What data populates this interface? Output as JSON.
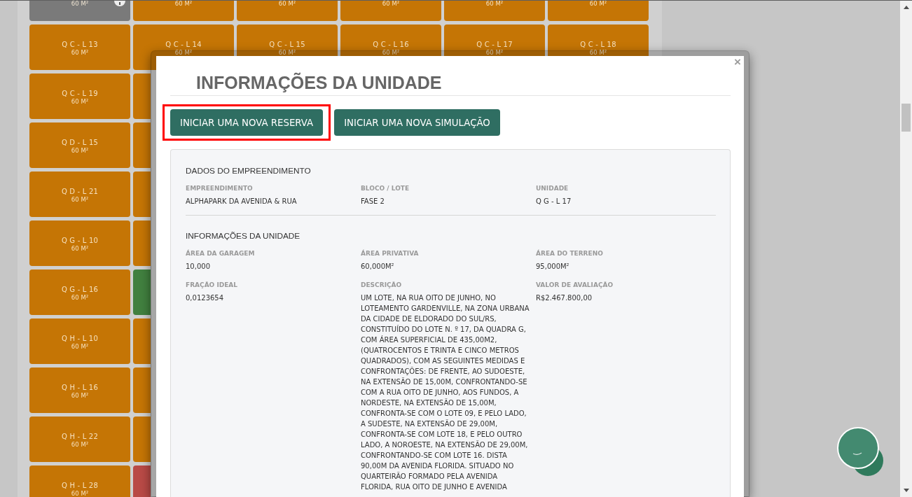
{
  "grid": {
    "rows": [
      {
        "tiles": [
          {
            "area": "60 M²",
            "color": "#7a7a7a",
            "info_badge": true
          },
          {
            "area": "60 M²",
            "color": "#c57505",
            "info_badge": false
          },
          {
            "area": "60 M²",
            "color": "#c57505",
            "info_badge": false
          },
          {
            "area": "60 M²",
            "color": "#c57505",
            "info_badge": false
          },
          {
            "area": "60 M²",
            "color": "#c57505",
            "info_badge": false
          },
          {
            "area": "60 M²",
            "color": "#c57505",
            "info_badge": false
          }
        ]
      },
      {
        "tiles": [
          {
            "label": "Q C - L 13",
            "area": "60 M²",
            "color": "#c57505",
            "info_badge": false
          },
          {
            "label": "Q C - L 14",
            "area": "60 M²",
            "color": "#c57505",
            "info_badge": false
          },
          {
            "label": "Q C - L 15",
            "area": "60 M²",
            "color": "#c57505",
            "info_badge": false
          },
          {
            "label": "Q C - L 16",
            "area": "60 M²",
            "color": "#c57505",
            "info_badge": false
          },
          {
            "label": "Q C - L 17",
            "area": "60 M²",
            "color": "#c57505",
            "info_badge": false
          },
          {
            "label": "Q C - L 18",
            "area": "60 M²",
            "color": "#c57505",
            "info_badge": false
          }
        ]
      },
      {
        "tiles": [
          {
            "label": "Q C - L 19",
            "area": "60 M²",
            "color": "#c57505",
            "info_badge": false
          },
          {
            "color": "#c57505",
            "info_badge": false
          }
        ]
      },
      {
        "tiles": [
          {
            "label": "Q D - L 15",
            "area": "60 M²",
            "color": "#c57505",
            "info_badge": false
          },
          {
            "color": "#c57505",
            "info_badge": false
          }
        ]
      },
      {
        "tiles": [
          {
            "label": "Q D - L 21",
            "area": "60 M²",
            "color": "#c57505",
            "info_badge": false
          },
          {
            "color": "#c57505",
            "info_badge": false
          }
        ]
      },
      {
        "tiles": [
          {
            "label": "Q G - L 10",
            "area": "60 M²",
            "color": "#c57505",
            "info_badge": false
          },
          {
            "color": "#c57505",
            "info_badge": false
          }
        ]
      },
      {
        "tiles": [
          {
            "label": "Q G - L 16",
            "area": "60 M²",
            "color": "#c57505",
            "info_badge": false
          },
          {
            "color": "#41803f",
            "info_badge": false
          }
        ]
      },
      {
        "tiles": [
          {
            "label": "Q H - L 10",
            "area": "60 M²",
            "color": "#c57505",
            "info_badge": false
          },
          {
            "color": "#c57505",
            "info_badge": false
          }
        ]
      },
      {
        "tiles": [
          {
            "label": "Q H - L 16",
            "area": "60 M²",
            "color": "#c57505",
            "info_badge": false
          },
          {
            "color": "#c57505",
            "info_badge": false
          }
        ]
      },
      {
        "tiles": [
          {
            "label": "Q H - L 22",
            "area": "60 M²",
            "color": "#c57505",
            "info_badge": false
          },
          {
            "color": "#c57505",
            "info_badge": false
          }
        ]
      },
      {
        "tiles": [
          {
            "label": "Q H - L 28",
            "area": "60 M²",
            "color": "#c57505",
            "info_badge": false
          },
          {
            "color": "#b94a46",
            "info_badge": false
          }
        ]
      }
    ]
  },
  "modal": {
    "close": "×",
    "title": "INFORMAÇÕES DA UNIDADE",
    "buttons": [
      {
        "label": "INICIAR UMA NOVA RESERVA",
        "highlighted": true
      },
      {
        "label": "INICIAR UMA NOVA SIMULAÇÃO",
        "highlighted": false
      }
    ],
    "sections": [
      {
        "title": "DADOS DO EMPREENDIMENTO",
        "fields": [
          {
            "label": "EMPREENDIMENTO",
            "value": "ALPHAPARK DA AVENIDA & RUA"
          },
          {
            "label": "BLOCO / LOTE",
            "value": "FASE 2"
          },
          {
            "label": "UNIDADE",
            "value": "Q G - L 17"
          }
        ]
      },
      {
        "title": "INFORMAÇÕES DA UNIDADE",
        "fields": [
          {
            "label": "ÁREA DA GARAGEM",
            "value": "10,000"
          },
          {
            "label": "ÁREA PRIVATIVA",
            "value": "60,000M²"
          },
          {
            "label": "ÁREA DO TERRENO",
            "value": "95,000M²"
          },
          {
            "label": "FRAÇÃO IDEAL",
            "value": "0,0123654"
          },
          {
            "label": "DESCRIÇÃO",
            "value": "UM LOTE, NA RUA OITO DE JUNHO, NO LOTEAMENTO GARDENVILLE, NA ZONA URBANA DA CIDADE DE ELDORADO DO SUL/RS, CONSTITUÍDO DO LOTE N. º 17, DA QUADRA G, COM ÁREA SUPERFICIAL DE 435,00M2, (QUATROCENTOS E TRINTA E CINCO METROS QUADRADOS), COM AS SEGUINTES MEDIDAS E CONFRONTAÇÕES: DE FRENTE, AO SUDOESTE, NA EXTENSÃO DE 15,00M, CONFRONTANDO-SE COM A RUA OITO DE JUNHO, AOS FUNDOS, A NORDESTE, NA EXTENSÃO DE 15,00M, CONFRONTA-SE COM O LOTE 09, E PELO LADO, A SUDESTE, NA EXTENSÃO DE 29,00M, CONFRONTA-SE COM LOTE 18, E PELO OUTRO LADO, A NOROESTE, NA EXTENSÃO DE 29,00M, CONFRONTANDO-SE COM LOTE 16. DISTA 90,00M DA AVENIDA FLORIDA. SITUADO NO QUARTEIRÃO FORMADO PELA AVENIDA FLORIDA, RUA OITO DE JUNHO E AVENIDA"
          },
          {
            "label": "VALOR DE AVALIAÇÃO",
            "value": "R$2.467.800,00"
          }
        ]
      }
    ]
  }
}
